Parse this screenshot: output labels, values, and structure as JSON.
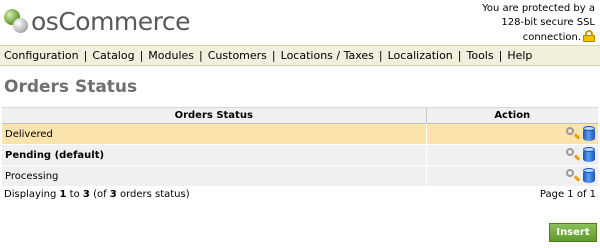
{
  "header": {
    "logo_text": "osCommerce",
    "ssl_line1": "You are protected by a",
    "ssl_line2": "128-bit secure SSL",
    "ssl_line3": "connection.",
    "lock_icon": "lock-icon"
  },
  "nav": {
    "items": [
      {
        "label": "Configuration"
      },
      {
        "label": "Catalog"
      },
      {
        "label": "Modules"
      },
      {
        "label": "Customers"
      },
      {
        "label": "Locations / Taxes"
      },
      {
        "label": "Localization"
      },
      {
        "label": "Tools"
      },
      {
        "label": "Help"
      }
    ],
    "separator": "|"
  },
  "page": {
    "title": "Orders Status"
  },
  "table": {
    "headers": {
      "status": "Orders Status",
      "action": "Action"
    },
    "rows": [
      {
        "status": "Delivered",
        "selected": true,
        "bold": false
      },
      {
        "status": "Pending (default)",
        "selected": false,
        "bold": true
      },
      {
        "status": "Processing",
        "selected": false,
        "bold": false
      }
    ],
    "action_icons": [
      "edit-icon",
      "info-icon"
    ]
  },
  "footer": {
    "displaying_prefix": "Displaying",
    "from": "1",
    "to_word": "to",
    "to": "3",
    "of_prefix": "(of",
    "total": "3",
    "suffix": "orders status)",
    "page_info": "Page 1 of 1"
  },
  "buttons": {
    "insert_label": "Insert"
  },
  "colors": {
    "nav_bg": "#f2efdd",
    "selected_row": "#fbe3ad",
    "row_bg": "#f0f0f0",
    "title_color": "#707070",
    "insert_button": "#6aa338"
  }
}
